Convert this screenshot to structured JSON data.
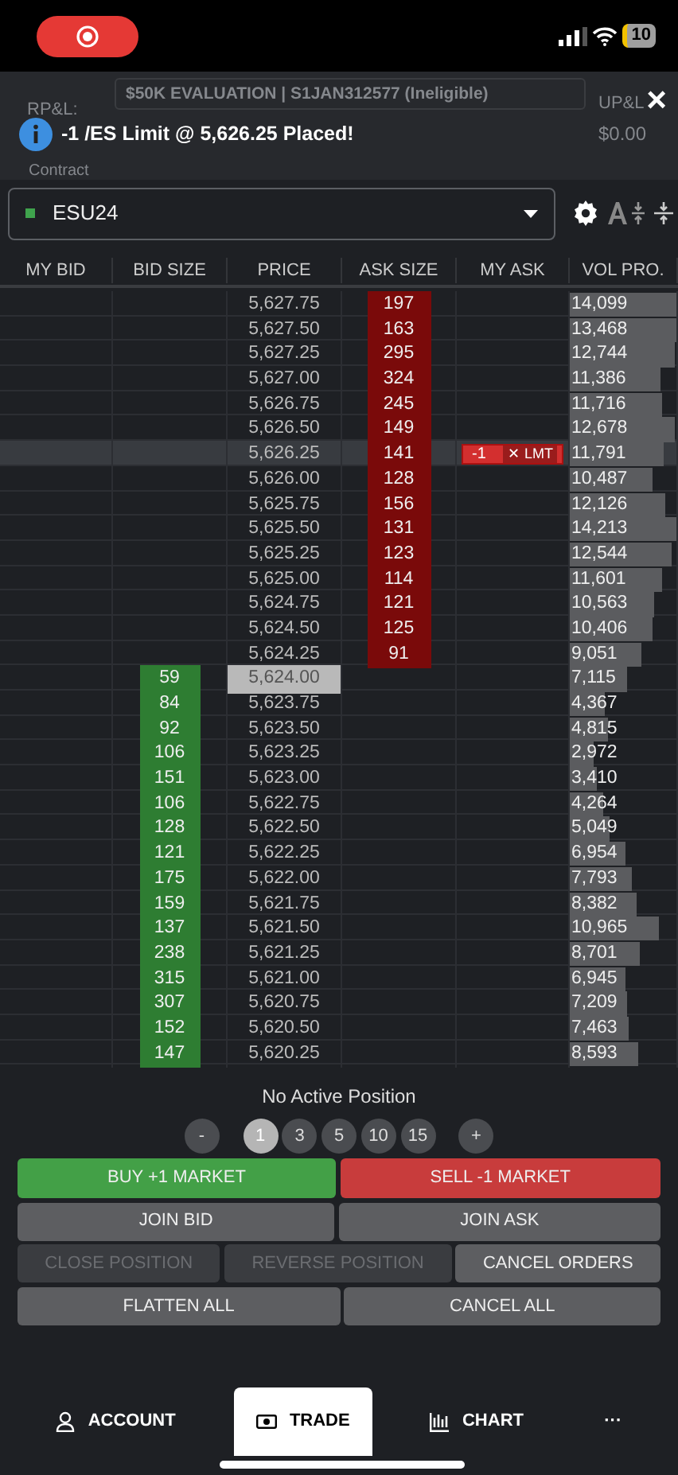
{
  "status_bar": {
    "battery": "10"
  },
  "account_header": {
    "rpl_label": "RP&L:",
    "account": "$50K EVALUATION | S1JAN312577 (Ineligible)",
    "upl_label": "UP&L",
    "upl_value": "$0.00",
    "contract_label": "Contract"
  },
  "toast": {
    "message": "-1 /ES Limit @ 5,626.25 Placed!",
    "close": "×"
  },
  "contract": {
    "symbol": "ESU24",
    "color": "#3fa34d"
  },
  "columns": [
    "MY BID",
    "BID SIZE",
    "PRICE",
    "ASK SIZE",
    "MY ASK",
    "VOL PRO."
  ],
  "rows": [
    {
      "price": "5,627.75",
      "ask_size": "197",
      "volume": "14,099",
      "level": 1.0
    },
    {
      "price": "5,627.50",
      "ask_size": "163",
      "volume": "13,468",
      "level": 1.0
    },
    {
      "price": "5,627.25",
      "ask_size": "295",
      "volume": "12,744",
      "level": 0.98
    },
    {
      "price": "5,627.00",
      "ask_size": "324",
      "volume": "11,386",
      "level": 0.85
    },
    {
      "price": "5,626.75",
      "ask_size": "245",
      "volume": "11,716",
      "level": 0.87
    },
    {
      "price": "5,626.50",
      "ask_size": "149",
      "volume": "12,678",
      "level": 0.98
    },
    {
      "price": "5,626.25",
      "ask_size": "141",
      "volume": "11,791",
      "level": 0.88,
      "selected": true,
      "my_ask": {
        "qty": "-1",
        "cancel": "✕",
        "type": "LMT"
      }
    },
    {
      "price": "5,626.00",
      "ask_size": "128",
      "volume": "10,487",
      "level": 0.78
    },
    {
      "price": "5,625.75",
      "ask_size": "156",
      "volume": "12,126",
      "level": 0.9
    },
    {
      "price": "5,625.50",
      "ask_size": "131",
      "volume": "14,213",
      "level": 1.0
    },
    {
      "price": "5,625.25",
      "ask_size": "123",
      "volume": "12,544",
      "level": 0.95
    },
    {
      "price": "5,625.00",
      "ask_size": "114",
      "volume": "11,601",
      "level": 0.86
    },
    {
      "price": "5,624.75",
      "ask_size": "121",
      "volume": "10,563",
      "level": 0.79
    },
    {
      "price": "5,624.50",
      "ask_size": "125",
      "volume": "10,406",
      "level": 0.77
    },
    {
      "price": "5,624.25",
      "ask_size": "91",
      "volume": "9,051",
      "level": 0.67
    },
    {
      "price": "5,624.00",
      "bid_size": "59",
      "volume": "7,115",
      "level": 0.53,
      "last": true
    },
    {
      "price": "5,623.75",
      "bid_size": "84",
      "volume": "4,367",
      "level": 0.33
    },
    {
      "price": "5,623.50",
      "bid_size": "92",
      "volume": "4,815",
      "level": 0.36
    },
    {
      "price": "5,623.25",
      "bid_size": "106",
      "volume": "2,972",
      "level": 0.22
    },
    {
      "price": "5,623.00",
      "bid_size": "151",
      "volume": "3,410",
      "level": 0.25
    },
    {
      "price": "5,622.75",
      "bid_size": "106",
      "volume": "4,264",
      "level": 0.32
    },
    {
      "price": "5,622.50",
      "bid_size": "128",
      "volume": "5,049",
      "level": 0.37
    },
    {
      "price": "5,622.25",
      "bid_size": "121",
      "volume": "6,954",
      "level": 0.52
    },
    {
      "price": "5,622.00",
      "bid_size": "175",
      "volume": "7,793",
      "level": 0.58
    },
    {
      "price": "5,621.75",
      "bid_size": "159",
      "volume": "8,382",
      "level": 0.62
    },
    {
      "price": "5,621.50",
      "bid_size": "137",
      "volume": "10,965",
      "level": 0.83
    },
    {
      "price": "5,621.25",
      "bid_size": "238",
      "volume": "8,701",
      "level": 0.65
    },
    {
      "price": "5,621.00",
      "bid_size": "315",
      "volume": "6,945",
      "level": 0.52
    },
    {
      "price": "5,620.75",
      "bid_size": "307",
      "volume": "7,209",
      "level": 0.53
    },
    {
      "price": "5,620.50",
      "bid_size": "152",
      "volume": "7,463",
      "level": 0.55
    },
    {
      "price": "5,620.25",
      "bid_size": "147",
      "volume": "8,593",
      "level": 0.64
    }
  ],
  "position": "No Active Position",
  "quantities": [
    {
      "label": "-",
      "kind": "step",
      "selected": false
    },
    {
      "label": "1",
      "kind": "qty",
      "selected": true
    },
    {
      "label": "3",
      "kind": "qty",
      "selected": false
    },
    {
      "label": "5",
      "kind": "qty",
      "selected": false
    },
    {
      "label": "10",
      "kind": "qty",
      "selected": false
    },
    {
      "label": "15",
      "kind": "qty",
      "selected": false
    },
    {
      "label": "+",
      "kind": "step",
      "selected": false
    }
  ],
  "button_rows": [
    [
      {
        "label": "BUY +1 MARKET",
        "kind": "buy",
        "disabled": false
      },
      {
        "label": "SELL -1 MARKET",
        "kind": "sell",
        "disabled": false
      }
    ],
    [
      {
        "label": "JOIN BID",
        "kind": "plain",
        "disabled": false
      },
      {
        "label": "JOIN ASK",
        "kind": "plain",
        "disabled": false
      }
    ],
    [
      {
        "label": "CLOSE POSITION",
        "kind": "plain",
        "disabled": true
      },
      {
        "label": "REVERSE POSITION",
        "kind": "plain",
        "disabled": true
      },
      {
        "label": "CANCEL ORDERS",
        "kind": "plain",
        "disabled": false
      }
    ],
    [
      {
        "label": "FLATTEN ALL",
        "kind": "plain",
        "disabled": false
      },
      {
        "label": "CANCEL ALL",
        "kind": "plain",
        "disabled": false
      }
    ]
  ],
  "nav": [
    {
      "label": "ACCOUNT",
      "kind": "account",
      "selected": false
    },
    {
      "label": "TRADE",
      "kind": "trade",
      "selected": true
    },
    {
      "label": "CHART",
      "kind": "chart",
      "selected": false
    },
    {
      "label": "···",
      "kind": "more",
      "selected": false
    }
  ]
}
